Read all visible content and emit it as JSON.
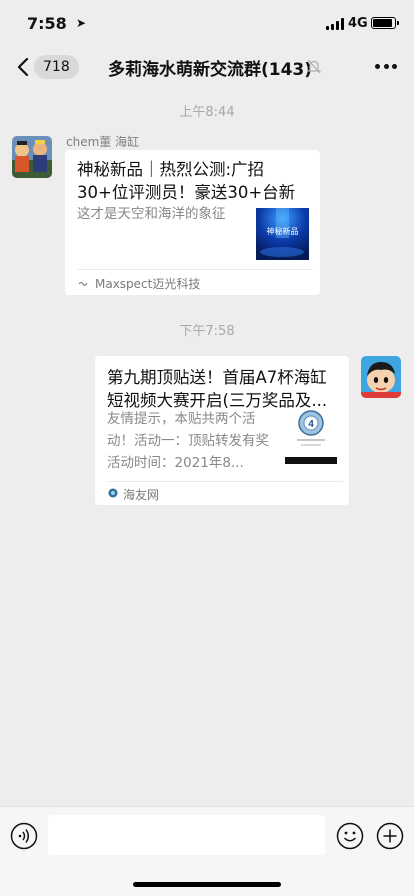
{
  "status_bar": {
    "time": "7:58",
    "location_arrow": "➤",
    "network": "4G",
    "battery_level": 0.9
  },
  "nav": {
    "back_count": "718",
    "title": "多莉海水萌新交流群(143)",
    "back_icon": "chevron-left-icon",
    "mute_icon": "bell-slash-icon",
    "more_icon": "more-horizontal-icon"
  },
  "messages": [
    {
      "timestamp": "上午8:44",
      "sender": "chem董 海缸",
      "card": {
        "title": "神秘新品｜热烈公测:广招30+位评测员！豪送30+台新品...",
        "desc": "这才是天空和海洋的象征",
        "thumb_text": "神秘新品",
        "source": "Maxspect迈光科技"
      }
    },
    {
      "timestamp": "下午7:58",
      "card": {
        "title": "第九期顶贴送！首届A7杯海缸短视频大赛开启(三万奖品及...",
        "desc": "友情提示，本贴共两个活动！活动一：顶贴转发有奖活动时间：2021年8...",
        "source": "海友网"
      }
    }
  ],
  "input_bar": {
    "voice_icon": "voice-icon",
    "emoji_icon": "emoji-icon",
    "plus_icon": "plus-circle-icon"
  },
  "colors": {
    "background": "#ededed",
    "card": "#ffffff",
    "muted_text": "#888888"
  }
}
